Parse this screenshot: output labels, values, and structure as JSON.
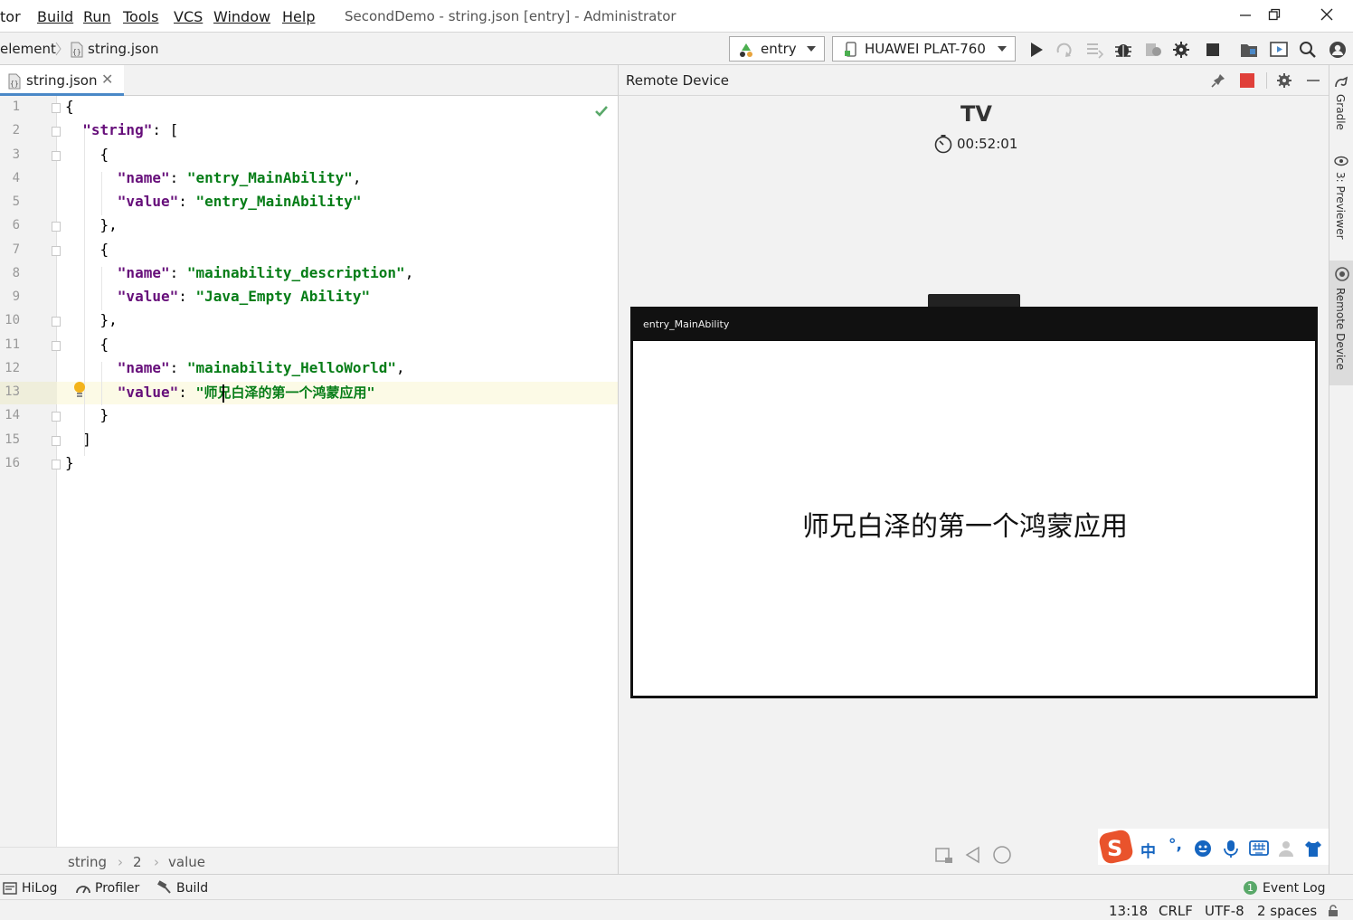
{
  "menu": {
    "items": [
      "tor",
      "Build",
      "Run",
      "Tools",
      "VCS",
      "Window",
      "Help"
    ],
    "title": "SecondDemo - string.json [entry] - Administrator"
  },
  "nav": {
    "crumb_parent": "element",
    "crumb_file": "string.json",
    "module_combo": "entry",
    "device_combo": "HUAWEI PLAT-760"
  },
  "editor": {
    "tab_label": "string.json",
    "line_numbers": [
      "1",
      "2",
      "3",
      "4",
      "5",
      "6",
      "7",
      "8",
      "9",
      "10",
      "11",
      "12",
      "13",
      "14",
      "15",
      "16"
    ],
    "breadcrumb": [
      "string",
      "2",
      "value"
    ]
  },
  "code": {
    "l1": "{",
    "l2_key": "\"string\"",
    "l2_rest": ": [",
    "l3": "{",
    "l4_key": "\"name\"",
    "l4_val": "\"entry_MainAbility\"",
    "l5_key": "\"value\"",
    "l5_val": "\"entry_MainAbility\"",
    "l6": "},",
    "l7": "{",
    "l8_key": "\"name\"",
    "l8_val": "\"mainability_description\"",
    "l9_key": "\"value\"",
    "l9_val": "\"Java_Empty Ability\"",
    "l10": "},",
    "l11": "{",
    "l12_key": "\"name\"",
    "l12_val": "\"mainability_HelloWorld\"",
    "l13_key": "\"value\"",
    "l13_val": "\"师兄白泽的第一个鸿蒙应用\"",
    "l14": "}",
    "l15": "]",
    "l16": "}"
  },
  "remote": {
    "panel_title": "Remote Device",
    "device_name": "TV",
    "timer": "00:52:01",
    "app_title": "entry_MainAbility",
    "hello_text": "师兄白泽的第一个鸿蒙应用"
  },
  "side": {
    "gradle": "Gradle",
    "previewer": "3: Previewer",
    "remote_device": "Remote Device"
  },
  "bottom_tools": {
    "hilog": "HiLog",
    "profiler": "Profiler",
    "build": "Build",
    "event_log": "Event Log",
    "event_count": "1"
  },
  "status": {
    "position": "13:18",
    "line_sep": "CRLF",
    "encoding": "UTF-8",
    "indent": "2 spaces"
  },
  "ime": {
    "mode": "中"
  },
  "colors": {
    "accent": "#4a88c7",
    "string": "#067d17",
    "key": "#660e7a",
    "stop": "#e0403a"
  }
}
